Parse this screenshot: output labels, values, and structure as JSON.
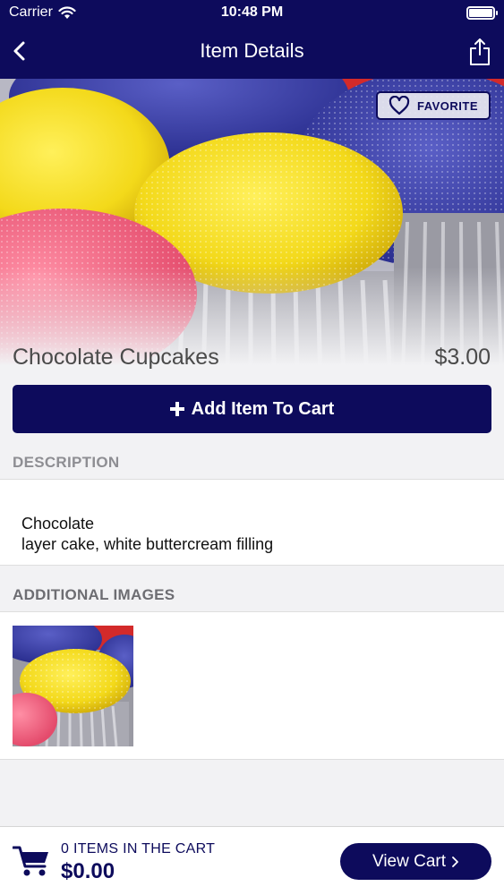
{
  "status_bar": {
    "carrier": "Carrier",
    "time": "10:48 PM"
  },
  "nav": {
    "title": "Item Details"
  },
  "hero": {
    "favorite_label": "FAVORITE"
  },
  "item": {
    "name": "Chocolate Cupcakes",
    "price": "$3.00"
  },
  "actions": {
    "add_to_cart": "Add Item To Cart"
  },
  "description": {
    "header": "DESCRIPTION",
    "text": "Chocolate\nlayer cake, white buttercream filling"
  },
  "additional_images": {
    "header": "ADDITIONAL IMAGES"
  },
  "cart": {
    "count_text": "0 ITEMS IN THE CART",
    "total": "$0.00",
    "view_cart_label": "View Cart"
  },
  "colors": {
    "primary": "#0d0b5c",
    "background": "#f2f2f4"
  },
  "icons": [
    "wifi-icon",
    "battery-icon",
    "back-chevron-icon",
    "share-icon",
    "heart-icon",
    "plus-icon",
    "cart-icon",
    "chevron-right-icon"
  ]
}
